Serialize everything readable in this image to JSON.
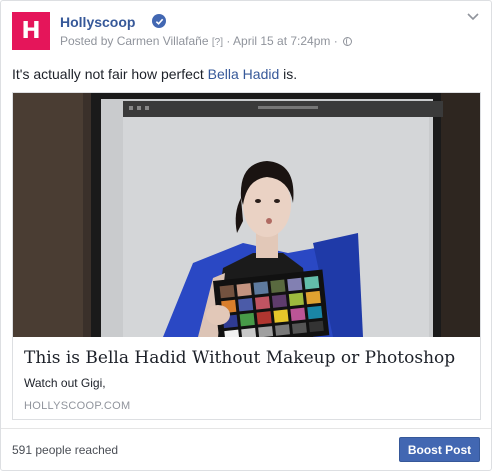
{
  "page": {
    "name": "Hollyscoop",
    "logo_text": "H",
    "verified_icon": "verified-badge-icon",
    "brand_color": "#e5155a"
  },
  "meta": {
    "posted_by": "Posted by Carmen Villafañe",
    "help_marker": "[?]",
    "separator": "·",
    "date": "April 15 at 7:24pm",
    "audience_icon": "globe-icon"
  },
  "post": {
    "text_before": "It's actually not fair how perfect ",
    "link_text": "Bella Hadid",
    "text_after": " is."
  },
  "preview": {
    "image_subject": "woman holding color checker card in front of monitor",
    "title": "This is Bella Hadid Without Makeup or Photoshop",
    "description": "Watch out Gigi,",
    "domain": "HOLLYSCOOP.COM"
  },
  "footer": {
    "reach": "591 people reached",
    "boost_label": "Boost Post",
    "accent_color": "#4267b2"
  }
}
